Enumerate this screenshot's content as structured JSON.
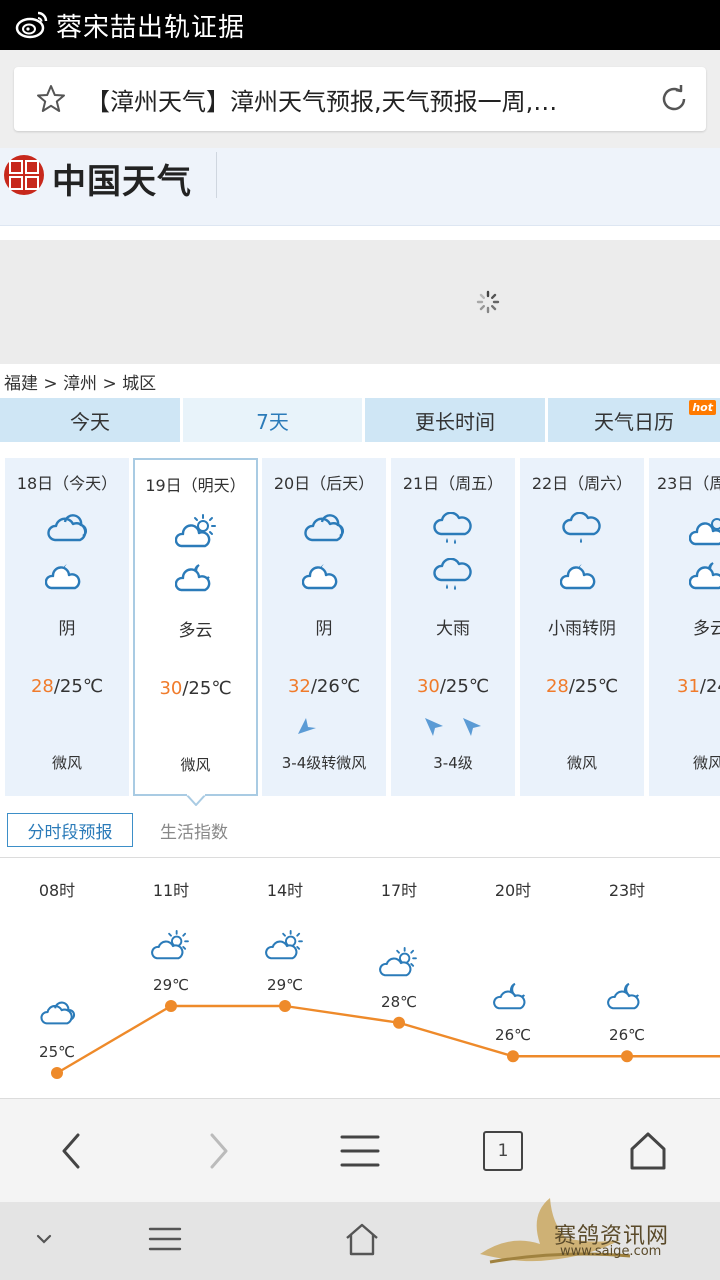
{
  "notification": {
    "title": "蓉宋喆出轨证据"
  },
  "urlbar": {
    "url_text": "【漳州天气】漳州天气预报,天气预报一周,…"
  },
  "site": {
    "logo_text": "中国天气"
  },
  "breadcrumb": "福建 > 漳州 > 城区",
  "tabs": [
    {
      "label": "今天"
    },
    {
      "label": "7天"
    },
    {
      "label": "更长时间"
    },
    {
      "label": "天气日历",
      "badge": "hot"
    }
  ],
  "days": [
    {
      "date": "18日（今天）",
      "day_icon": "cloudy-icon",
      "night_icon": "cloudy-night-icon",
      "condition": "阴",
      "high": "28",
      "low": "/25℃",
      "wind": "微风"
    },
    {
      "date": "19日（明天）",
      "day_icon": "partly-cloudy-sun-icon",
      "night_icon": "partly-cloudy-moon-icon",
      "condition": "多云",
      "high": "30",
      "low": "/25℃",
      "wind": "微风"
    },
    {
      "date": "20日（后天）",
      "day_icon": "cloudy-icon",
      "night_icon": "cloudy-night-icon",
      "condition": "阴",
      "high": "32",
      "low": "/26℃",
      "wind": "3-4级转微风"
    },
    {
      "date": "21日（周五）",
      "day_icon": "heavy-rain-icon",
      "night_icon": "heavy-rain-icon",
      "condition": "大雨",
      "high": "30",
      "low": "/25℃",
      "wind": "3-4级"
    },
    {
      "date": "22日（周六）",
      "day_icon": "light-rain-icon",
      "night_icon": "cloudy-night-icon",
      "condition": "小雨转阴",
      "high": "28",
      "low": "/25℃",
      "wind": "微风"
    },
    {
      "date": "23日（周",
      "day_icon": "partly-cloudy-sun-icon",
      "night_icon": "partly-cloudy-moon-icon",
      "condition": "多云",
      "high": "31",
      "low": "/24",
      "wind": "微风"
    }
  ],
  "subtabs": {
    "active": "分时段预报",
    "other": "生活指数"
  },
  "hourly": {
    "times": [
      "08时",
      "11时",
      "14时",
      "17时",
      "20时",
      "23时"
    ],
    "temps": [
      "25℃",
      "29℃",
      "29℃",
      "28℃",
      "26℃",
      "26℃"
    ],
    "icons": [
      "cloudy-icon",
      "partly-cloudy-sun-icon",
      "partly-cloudy-sun-icon",
      "partly-cloudy-sun-icon",
      "cloudy-night-icon",
      "cloudy-night-icon"
    ]
  },
  "chart_data": {
    "type": "line",
    "categories": [
      "08时",
      "11时",
      "14时",
      "17时",
      "20时",
      "23时"
    ],
    "series": [
      {
        "values": [
          25,
          29,
          29,
          28,
          26,
          26
        ]
      }
    ],
    "unit": "℃",
    "color": "#ee8a2a"
  },
  "toolbar": {
    "tab_count": "1"
  },
  "watermark": {
    "text": "赛鸽资讯网",
    "url": "www.saige.com"
  },
  "colors": {
    "accent": "#2b7bb9",
    "high_temp": "#f07b2b",
    "tab_bg": "#cfe6f5",
    "line": "#ee8a2a"
  }
}
